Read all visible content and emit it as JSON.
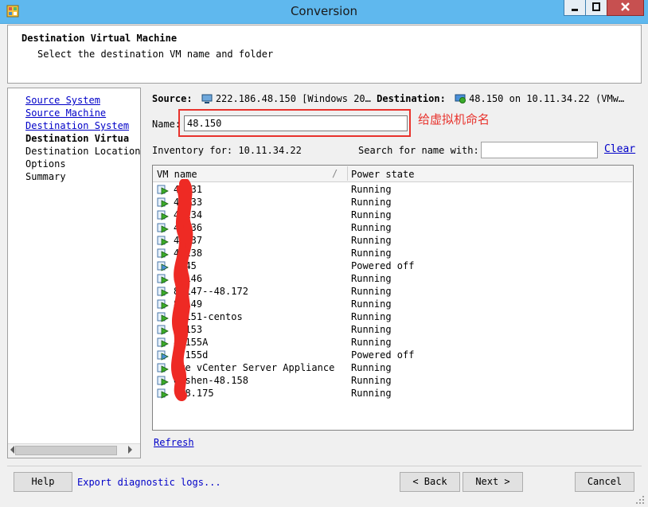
{
  "window": {
    "title": "Conversion"
  },
  "header": {
    "title": "Destination Virtual Machine",
    "subtitle": "Select the destination VM name and folder"
  },
  "nav": {
    "items": [
      {
        "label": "Source System",
        "style": "link"
      },
      {
        "label": "Source Machine",
        "style": "link"
      },
      {
        "label": "Destination System",
        "style": "link"
      },
      {
        "label": "Destination Virtua",
        "style": "current"
      },
      {
        "label": "Destination Location",
        "style": "plain"
      },
      {
        "label": "Options",
        "style": "plain"
      },
      {
        "label": "Summary",
        "style": "plain"
      }
    ]
  },
  "source_line": {
    "source_label": "Source:",
    "source_value": "222.186.48.150 [Windows 20…",
    "dest_label": "Destination:",
    "dest_value": "48.150 on 10.11.34.22 (VMw…"
  },
  "name_field": {
    "label": "Name:",
    "value": "48.150"
  },
  "annotation": "给虚拟机命名",
  "inventory": {
    "label": "Inventory for: 10.11.34.22"
  },
  "search": {
    "label": "Search for name with:",
    "value": "",
    "clear": "Clear"
  },
  "table": {
    "columns": [
      "VM name",
      "Power state"
    ],
    "rows": [
      {
        "name": "4 131",
        "state": "Running",
        "on": true
      },
      {
        "name": "4 133",
        "state": "Running",
        "on": true
      },
      {
        "name": "4 134",
        "state": "Running",
        "on": true
      },
      {
        "name": "4 136",
        "state": "Running",
        "on": true
      },
      {
        "name": "4 137",
        "state": "Running",
        "on": true
      },
      {
        "name": "4 138",
        "state": "Running",
        "on": true
      },
      {
        "name": ". 45",
        "state": "Powered off",
        "on": false
      },
      {
        "name": "8 146",
        "state": "Running",
        "on": true
      },
      {
        "name": "8 147--48.172",
        "state": "Running",
        "on": true
      },
      {
        "name": "8 149",
        "state": "Running",
        "on": true
      },
      {
        "name": "8 151-centos",
        "state": "Running",
        "on": true
      },
      {
        "name": "8 153",
        "state": "Running",
        "on": true
      },
      {
        "name": "8 155A",
        "state": "Running",
        "on": true
      },
      {
        "name": "8 155d",
        "state": "Powered off",
        "on": false
      },
      {
        "name": "are vCenter Server Appliance",
        "state": "Running",
        "on": true
      },
      {
        "name": "eishen-48.158",
        "state": "Running",
        "on": true
      },
      {
        "name": "-48.175",
        "state": "Running",
        "on": true
      }
    ]
  },
  "refresh": "Refresh",
  "buttons": {
    "help": "Help",
    "export": "Export diagnostic logs...",
    "back": "< Back",
    "next": "Next >",
    "cancel": "Cancel"
  },
  "colors": {
    "titlebar": "#5fb8ee",
    "link": "#0000c8",
    "annotation": "#e8322c",
    "vm_running": "#3cab2b",
    "vm_off": "#4a8fd9"
  }
}
